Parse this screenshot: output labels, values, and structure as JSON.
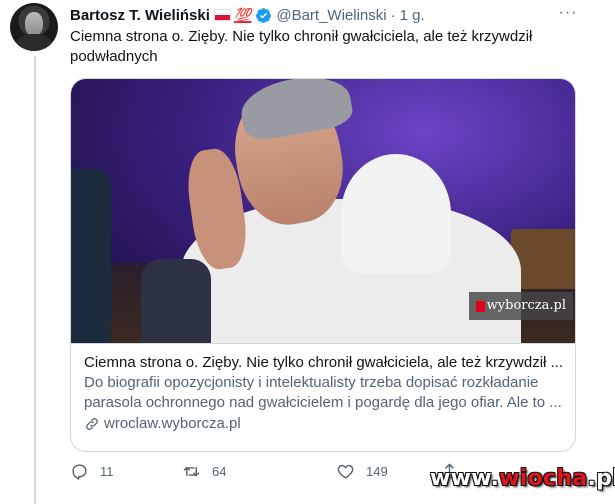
{
  "author": {
    "name": "Bartosz T. Wieliński",
    "emoji_badge": "💯",
    "handle": "@Bart_Wielinski",
    "separator": "·",
    "time": "1 g.",
    "more_label": "···"
  },
  "tweet": {
    "text": "Ciemna strona o. Zięby. Nie tylko chronił gwałciciela, ale też krzywdził podwładnych"
  },
  "card": {
    "image_watermark": "wyborcza.pl",
    "title": "Ciemna strona o. Zięby. Nie tylko chronił gwałciciela, ale też krzywdził ...",
    "description": "Do biografii opozycjonisty i intelektualisty trzeba dopisać rozkładanie parasola ochronnego nad gwałcicielem i pogardę dla jego ofiar. Ale to ...",
    "domain": "wroclaw.wyborcza.pl"
  },
  "actions": {
    "replies": "11",
    "retweets": "64",
    "likes": "149"
  },
  "watermark": {
    "prefix": "www.",
    "brand": "wiocha",
    "suffix": ".pl"
  },
  "colors": {
    "text_primary": "#0f1419",
    "text_secondary": "#536471",
    "border": "#cfd9de",
    "verified_blue": "#1d9bf0",
    "watermark_red": "#e3141b"
  }
}
